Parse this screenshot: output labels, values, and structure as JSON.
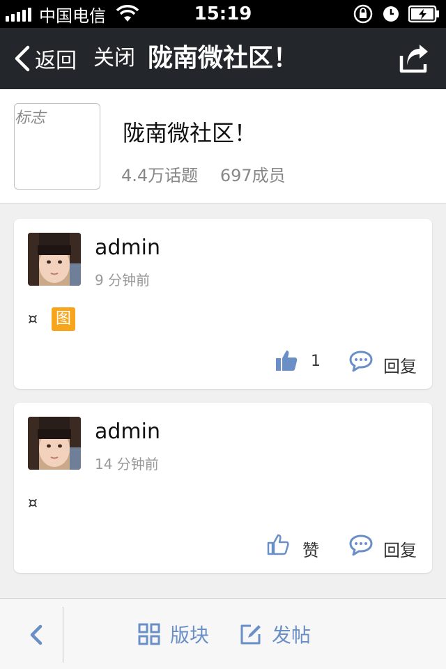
{
  "statusbar": {
    "carrier": "中国电信",
    "time": "15:19"
  },
  "navbar": {
    "back_label": "返回",
    "close_label": "关闭",
    "title": "陇南微社区！"
  },
  "group": {
    "logo_alt": "标志",
    "name": "陇南微社区！",
    "topics": "4.4万话题",
    "members": "697成员"
  },
  "posts": [
    {
      "author": "admin",
      "time": "9 分钟前",
      "content_glyph": "¤",
      "image_badge": "图",
      "likes": "1",
      "reply_label": "回复"
    },
    {
      "author": "admin",
      "time": "14 分钟前",
      "content_glyph": "¤",
      "like_label": "赞",
      "reply_label": "回复"
    }
  ],
  "toolbar": {
    "sections_label": "版块",
    "post_label": "发帖"
  },
  "colors": {
    "navbar_bg": "#23262a",
    "accent_blue": "#6a8fc7",
    "image_badge": "#f7a51c"
  },
  "icons": {
    "back": "chevron-left-icon",
    "share": "share-icon",
    "like": "thumbs-up-icon",
    "reply": "comment-icon",
    "sections": "grid-icon",
    "compose": "edit-icon"
  }
}
